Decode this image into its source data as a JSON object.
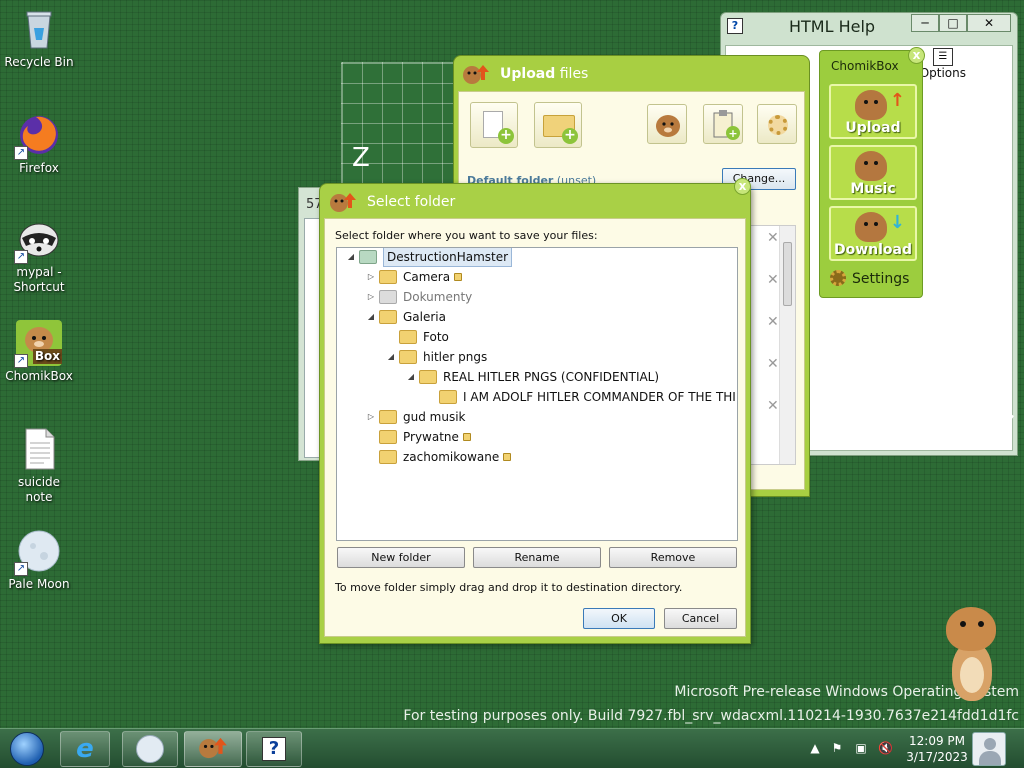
{
  "desktop": {
    "icons": [
      {
        "label": "Recycle Bin",
        "icon": "recycle-bin-icon"
      },
      {
        "label": "Firefox",
        "icon": "firefox-icon"
      },
      {
        "label": "mypal - Shortcut",
        "icon": "mypal-icon"
      },
      {
        "label": "ChomikBox",
        "icon": "chomikbox-icon"
      },
      {
        "label": "suicide note",
        "icon": "text-file-icon"
      },
      {
        "label": "Pale Moon",
        "icon": "pale-moon-icon"
      }
    ],
    "chomikbox_badge": "Box",
    "watermark": {
      "line1": "Microsoft Pre-release Windows Operating System",
      "line2": "For testing purposes only. Build 7927.fbl_srv_wdacxml.110214-1930.7637e214fdd1d1fc"
    }
  },
  "grid_window": {
    "letter": "Z"
  },
  "small_window": {
    "title": "57"
  },
  "help_window": {
    "title": "HTML Help",
    "minimize": "─",
    "maximize": "□",
    "close": "✕",
    "options_label": "Options"
  },
  "chomik_panel": {
    "title": "ChomikBox",
    "close": "x",
    "buttons": [
      {
        "label": "Upload",
        "arrow": "↑",
        "arrow_color": "#e2551b"
      },
      {
        "label": "Music",
        "arrow": "",
        "arrow_color": ""
      },
      {
        "label": "Download",
        "arrow": "↓",
        "arrow_color": "#2fb3d8"
      }
    ],
    "settings_label": "Settings"
  },
  "upload_window": {
    "title_bold": "Upload",
    "title_rest": " files",
    "default_folder_label": "Default folder",
    "default_folder_value": "(unset)",
    "change_button": "Change...",
    "row_remove": [
      "✕",
      "✕",
      "✕",
      "✕",
      "✕"
    ]
  },
  "select_folder": {
    "title": "Select folder",
    "close": "x",
    "prompt": "Select folder where you want to save your files:",
    "tree": [
      {
        "label": "DestructionHamster",
        "level": 0,
        "expander": "◢",
        "locked": false,
        "dim": false,
        "selected": true,
        "folder": "teal"
      },
      {
        "label": "Camera",
        "level": 1,
        "expander": "▷",
        "locked": true,
        "dim": false,
        "selected": false,
        "folder": "yellow"
      },
      {
        "label": "Dokumenty",
        "level": 1,
        "expander": "▷",
        "locked": false,
        "dim": true,
        "selected": false,
        "folder": "grey"
      },
      {
        "label": "Galeria",
        "level": 1,
        "expander": "◢",
        "locked": false,
        "dim": false,
        "selected": false,
        "folder": "yellow"
      },
      {
        "label": "Foto",
        "level": 2,
        "expander": "",
        "locked": false,
        "dim": false,
        "selected": false,
        "folder": "yellow"
      },
      {
        "label": "hitler pngs",
        "level": 2,
        "expander": "◢",
        "locked": false,
        "dim": false,
        "selected": false,
        "folder": "yellow"
      },
      {
        "label": "REAL HITLER PNGS (CONFIDENTIAL)",
        "level": 3,
        "expander": "◢",
        "locked": false,
        "dim": false,
        "selected": false,
        "folder": "yellow"
      },
      {
        "label": "I AM ADOLF HITLER COMMANDER OF THE THIR...",
        "level": 4,
        "expander": "",
        "locked": false,
        "dim": false,
        "selected": false,
        "folder": "yellow"
      },
      {
        "label": "gud musik",
        "level": 1,
        "expander": "▷",
        "locked": false,
        "dim": false,
        "selected": false,
        "folder": "yellow"
      },
      {
        "label": "Prywatne",
        "level": 1,
        "expander": "",
        "locked": true,
        "dim": false,
        "selected": false,
        "folder": "yellow"
      },
      {
        "label": "zachomikowane",
        "level": 1,
        "expander": "",
        "locked": true,
        "dim": false,
        "selected": false,
        "folder": "yellow"
      }
    ],
    "new_folder": "New folder",
    "rename": "Rename",
    "remove": "Remove",
    "hint": "To move folder simply drag and drop it to destination directory.",
    "ok": "OK",
    "cancel": "Cancel"
  },
  "taskbar": {
    "clock_time": "12:09 PM",
    "clock_date": "3/17/2023",
    "ie_glyph": "e",
    "help_glyph": "?"
  }
}
